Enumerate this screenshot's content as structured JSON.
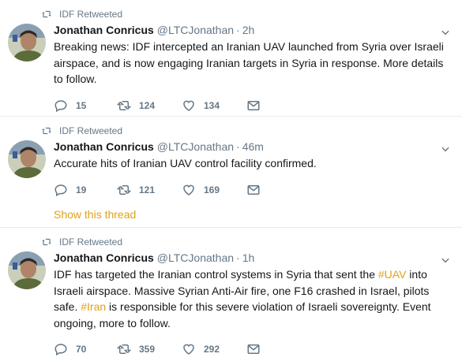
{
  "tweets": [
    {
      "retweeted_by": "IDF Retweeted",
      "name": "Jonathan Conricus",
      "handle": "@LTCJonathan",
      "time": "2h",
      "text": "Breaking news: IDF intercepted an Iranian UAV launched from Syria over Israeli airspace, and is now engaging Iranian targets in Syria in response. More details to follow.",
      "replies": "15",
      "retweets": "124",
      "likes": "134"
    },
    {
      "retweeted_by": "IDF Retweeted",
      "name": "Jonathan Conricus",
      "handle": "@LTCJonathan",
      "time": "46m",
      "text": "Accurate hits of Iranian UAV control facility confirmed.",
      "replies": "19",
      "retweets": "121",
      "likes": "169",
      "show_thread": "Show this thread"
    },
    {
      "retweeted_by": "IDF Retweeted",
      "name": "Jonathan Conricus",
      "handle": "@LTCJonathan",
      "time": "1h",
      "text_parts": {
        "p1": "IDF has targeted the Iranian control systems in Syria that sent the ",
        "tag1": "#UAV",
        "p2": " into Israeli airspace. Massive Syrian Anti-Air fire, one F16 crashed in Israel, pilots safe. ",
        "tag2": "#Iran",
        "p3": " is responsible for this severe violation of Israeli sovereignty. Event ongoing, more to follow."
      },
      "replies": "70",
      "retweets": "359",
      "likes": "292"
    }
  ],
  "separator": "·",
  "colors": {
    "link": "#e0a11a",
    "muted": "#657786",
    "text": "#14171a",
    "border": "#e6ecf0"
  },
  "icons": [
    "retweet-icon",
    "chevron-down-icon",
    "reply-icon",
    "like-icon",
    "direct-message-icon"
  ]
}
